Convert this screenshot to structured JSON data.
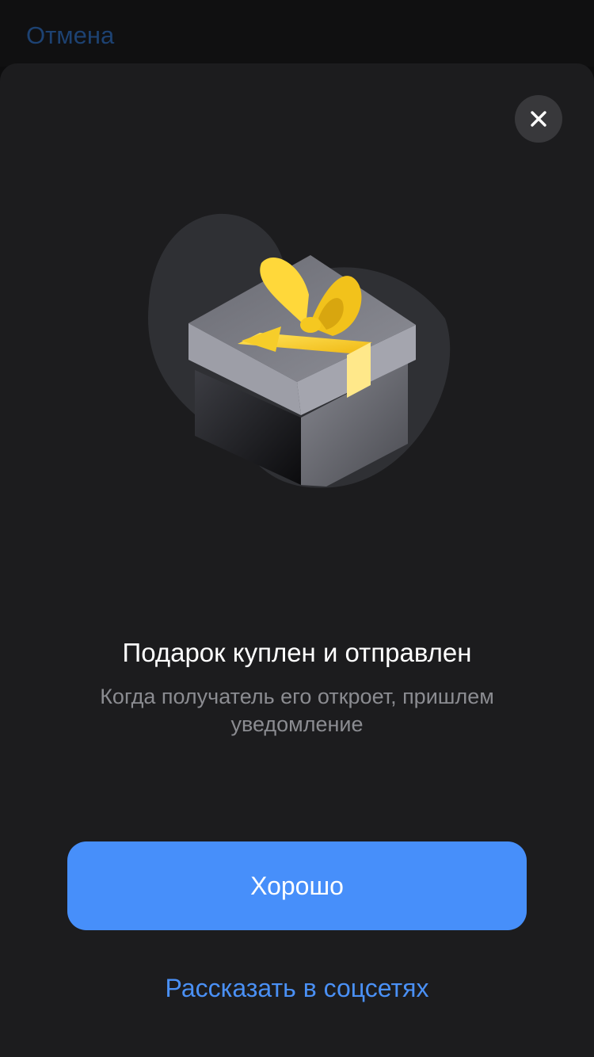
{
  "header": {
    "cancel_label": "Отмена"
  },
  "dialog": {
    "close_icon": "close-icon",
    "illustration": "gift-box-illustration",
    "title": "Подарок куплен и отправлен",
    "subtitle": "Когда получатель его откроет, пришлем уведомление",
    "primary_button_label": "Хорошо",
    "share_link_label": "Рассказать в соцсетях"
  },
  "colors": {
    "background": "#1c1c1e",
    "accent": "#478ffa",
    "link": "#4a90f5",
    "ribbon": "#ffd43b"
  }
}
